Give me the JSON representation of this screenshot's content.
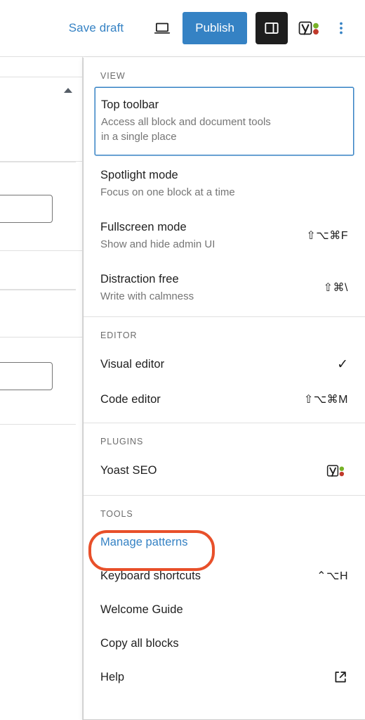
{
  "toolbar": {
    "save_draft_label": "Save draft",
    "preview_icon": "laptop-preview-icon",
    "publish_label": "Publish",
    "sidebar_toggle_icon": "sidebar-panel-icon",
    "yoast_icon": "yoast-seo-icon",
    "more_options_icon": "kebab-menu-icon",
    "accent_color": "#3582c4"
  },
  "menu": {
    "groups": [
      {
        "label": "VIEW",
        "items": [
          {
            "title": "Top toolbar",
            "description": "Access all block and document tools in a single place",
            "shortcut": "",
            "selected": true
          },
          {
            "title": "Spotlight mode",
            "description": "Focus on one block at a time",
            "shortcut": ""
          },
          {
            "title": "Fullscreen mode",
            "description": "Show and hide admin UI",
            "shortcut": "⇧⌥⌘F"
          },
          {
            "title": "Distraction free",
            "description": "Write with calmness",
            "shortcut": "⇧⌘\\"
          }
        ]
      },
      {
        "label": "EDITOR",
        "items": [
          {
            "title": "Visual editor",
            "description": "",
            "shortcut": "",
            "checked": true
          },
          {
            "title": "Code editor",
            "description": "",
            "shortcut": "⇧⌥⌘M"
          }
        ]
      },
      {
        "label": "PLUGINS",
        "items": [
          {
            "title": "Yoast SEO",
            "description": "",
            "shortcut": "",
            "icon": "yoast-seo-icon"
          }
        ]
      },
      {
        "label": "TOOLS",
        "items": [
          {
            "title": "Manage patterns",
            "description": "",
            "shortcut": "",
            "is_link": true,
            "annotated": true
          },
          {
            "title": "Keyboard shortcuts",
            "description": "",
            "shortcut": "⌃⌥H"
          },
          {
            "title": "Welcome Guide",
            "description": "",
            "shortcut": ""
          },
          {
            "title": "Copy all blocks",
            "description": "",
            "shortcut": ""
          },
          {
            "title": "Help",
            "description": "",
            "shortcut": "",
            "icon": "external-link-icon"
          }
        ]
      }
    ]
  },
  "annotation": {
    "color": "#e8502a",
    "target": "Manage patterns"
  },
  "editor_background": {
    "collapse_icon": "collapse-triangle-icon",
    "inputs": [
      "",
      ""
    ]
  }
}
